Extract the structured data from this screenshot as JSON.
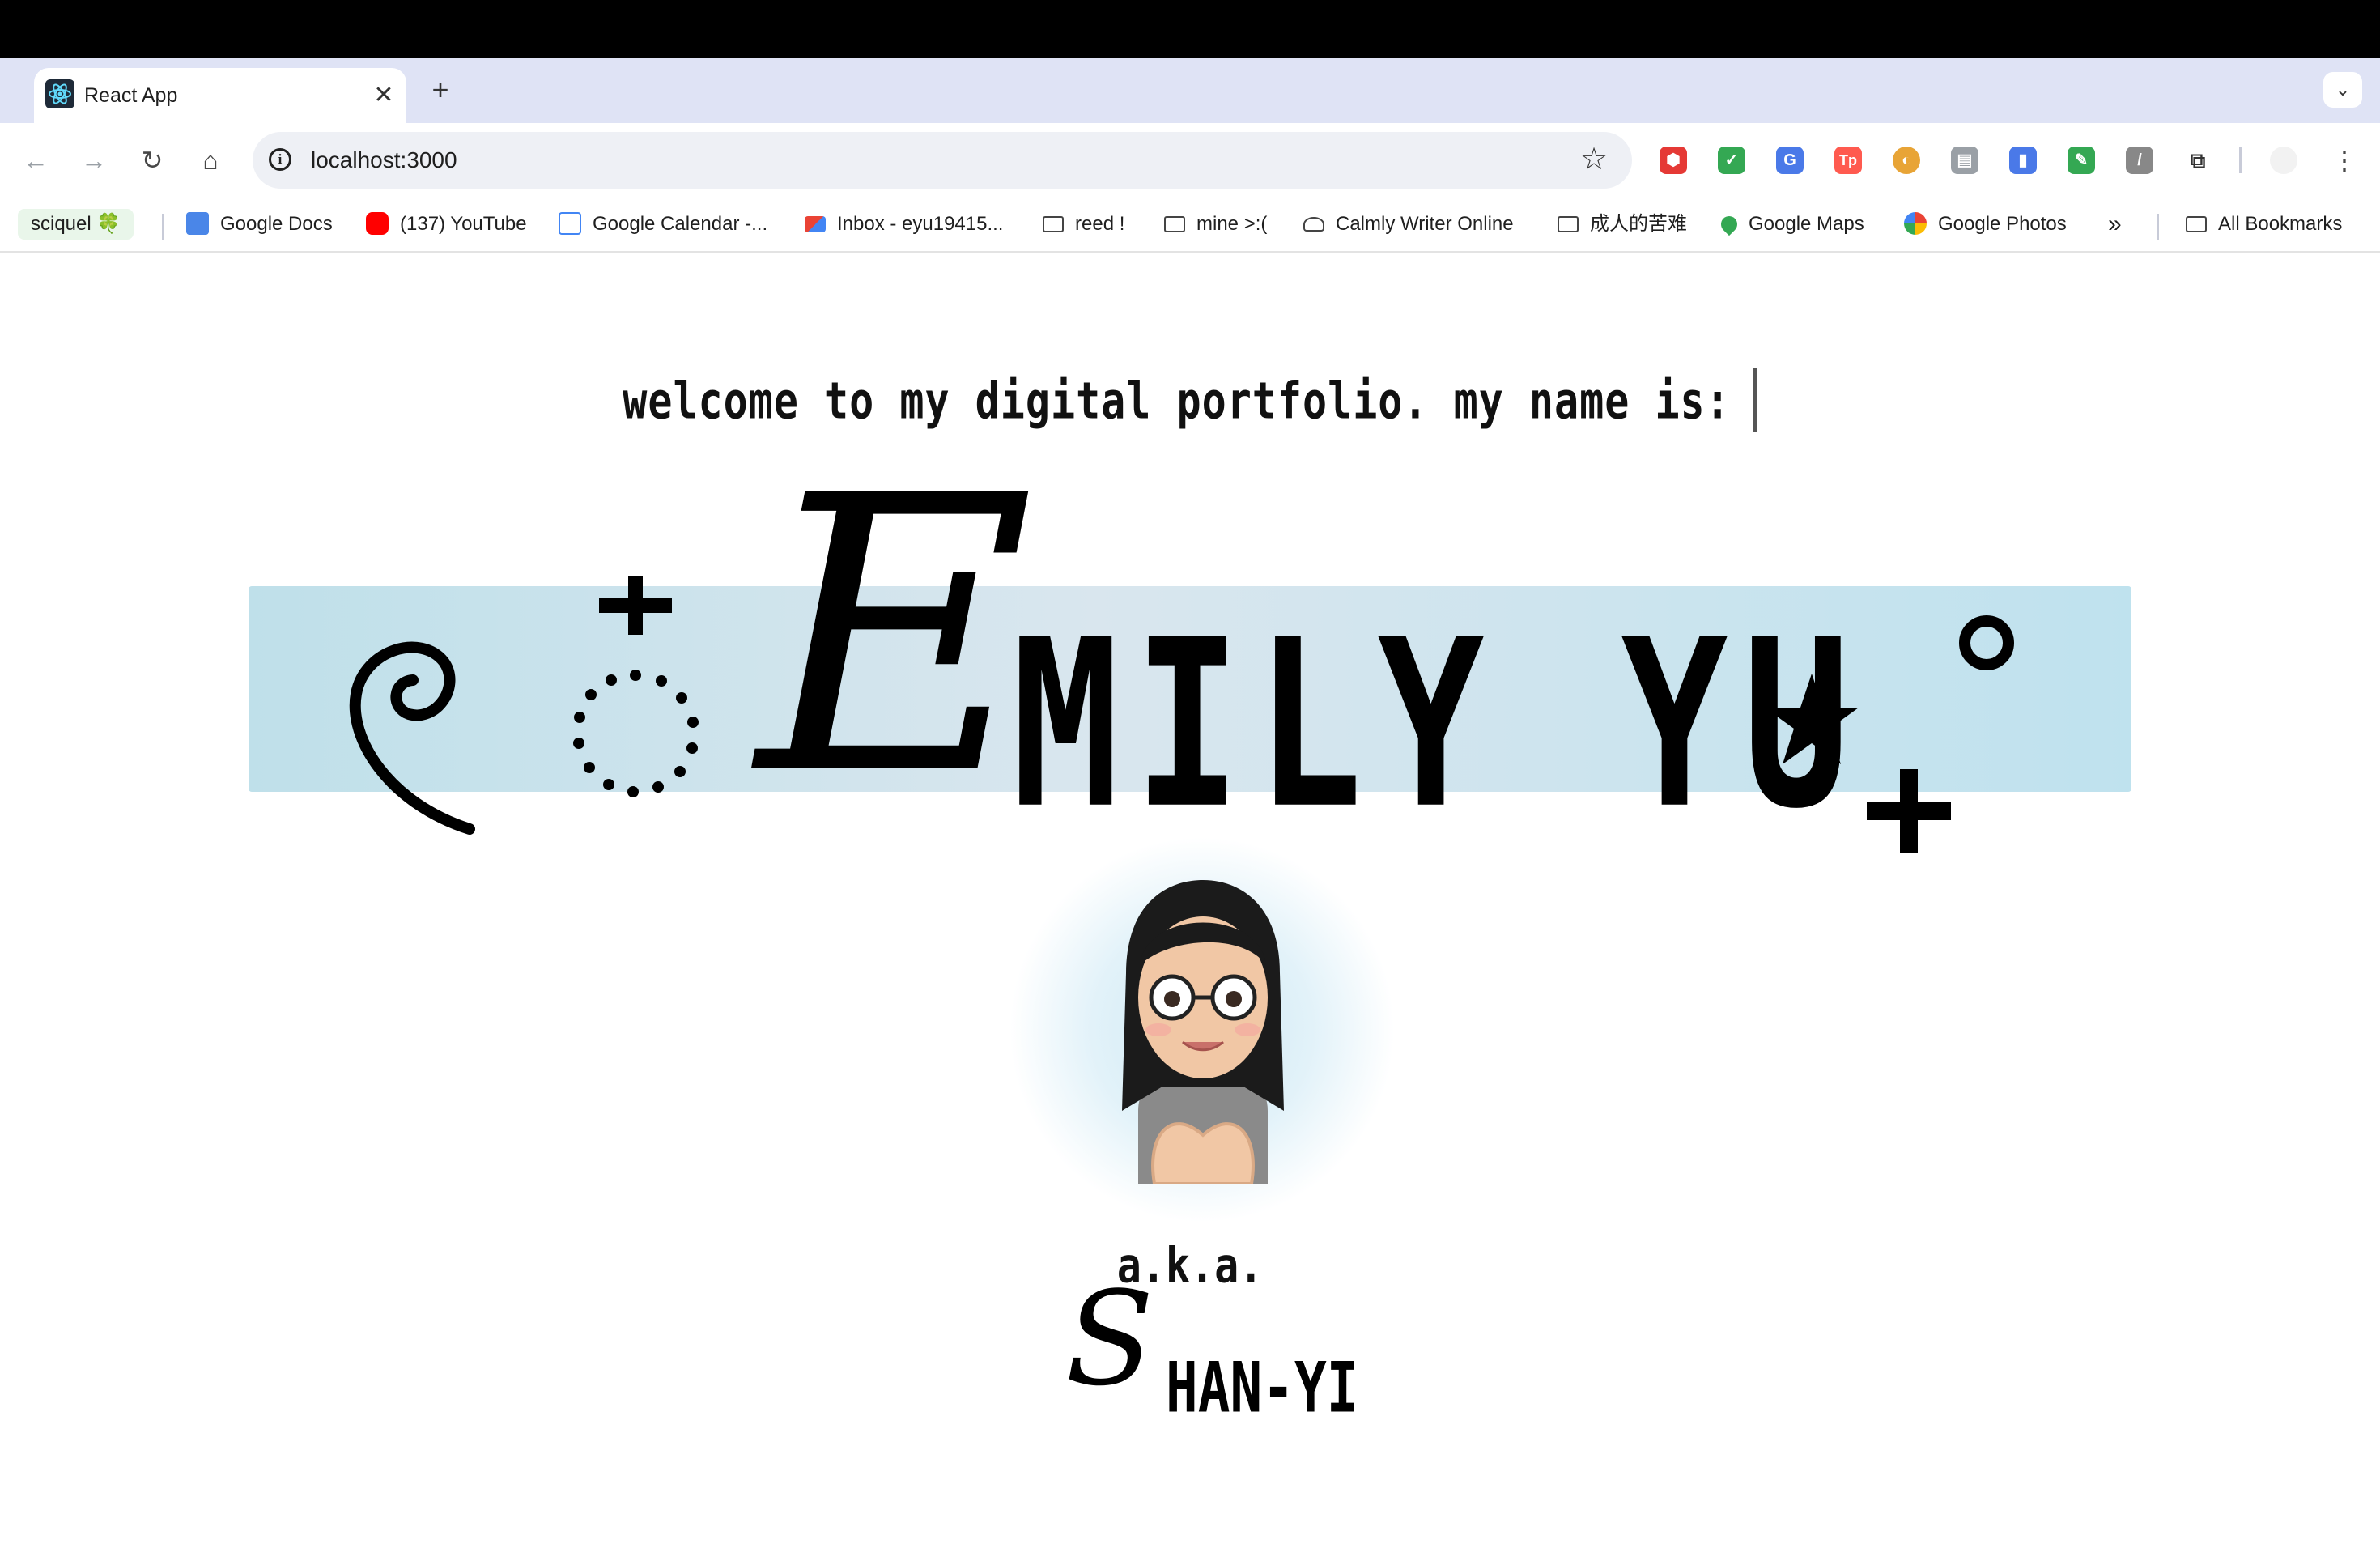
{
  "browser": {
    "tab": {
      "title": "React App",
      "close": "✕"
    },
    "new_tab": "+",
    "tab_menu": "⌄",
    "nav": {
      "back": "←",
      "forward": "→",
      "reload": "↻",
      "home": "⌂"
    },
    "address": {
      "url": "localhost:3000",
      "info_icon": "i",
      "bookmark_star": "☆"
    },
    "extensions": [
      {
        "name": "adblock-icon",
        "color": "#e53935",
        "glyph": "⬢"
      },
      {
        "name": "check-icon",
        "color": "#34a853",
        "glyph": "✓"
      },
      {
        "name": "translate-icon",
        "color": "#4a79e8",
        "glyph": "G"
      },
      {
        "name": "tp-icon",
        "color": "#ff5a4f",
        "glyph": "Tp"
      },
      {
        "name": "compass-icon",
        "color": "#e8a436",
        "glyph": "◐"
      },
      {
        "name": "document-icon",
        "color": "#9aa0a6",
        "glyph": "▤"
      },
      {
        "name": "barcode-icon",
        "color": "#4a79e8",
        "glyph": "▮"
      },
      {
        "name": "highlighter-icon",
        "color": "#34a853",
        "glyph": "✎"
      },
      {
        "name": "slash-icon",
        "color": "#888888",
        "glyph": "/"
      },
      {
        "name": "puzzle-icon",
        "color": "#555555",
        "glyph": "⧉"
      }
    ],
    "menu": "⋮"
  },
  "bookmarks": {
    "items": [
      {
        "label": "sciquel 🍀"
      },
      {
        "label": "Google Docs"
      },
      {
        "label": "(137) YouTube"
      },
      {
        "label": "Google Calendar -..."
      },
      {
        "label": "Inbox - eyu19415..."
      },
      {
        "label": "reed !"
      },
      {
        "label": "mine >:("
      },
      {
        "label": "Calmly Writer Online"
      },
      {
        "label": "成人的苦难"
      },
      {
        "label": "Google Maps"
      },
      {
        "label": "Google Photos"
      }
    ],
    "overflow": "»",
    "all_bookmarks": "All Bookmarks"
  },
  "hero": {
    "welcome": "welcome to my digital portfolio. my name is:",
    "name_initial": "E",
    "name_rest": "MILY YU",
    "aka": "a.k.a.",
    "alias_initial": "S",
    "alias_rest": "HAN-YI"
  },
  "colors": {
    "banner_left": "#bfe0ea",
    "banner_right": "#bfe2ee",
    "tabstrip": "#dfe3f5",
    "topbar": "#000000"
  }
}
